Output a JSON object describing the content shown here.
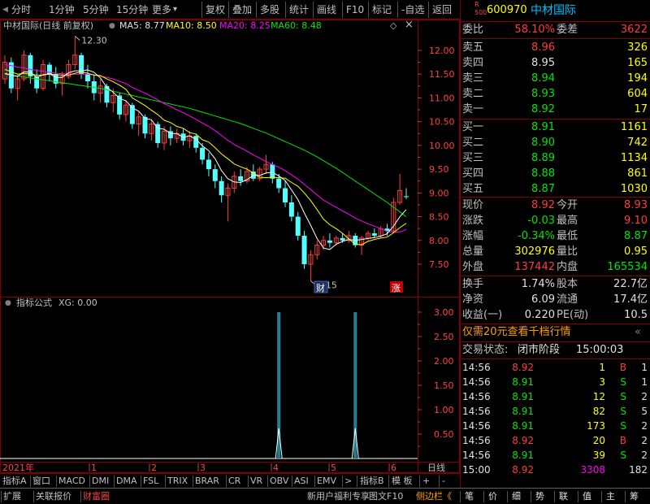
{
  "toolbar": {
    "left_items": [
      "分时",
      "1分钟",
      "5分钟",
      "15分钟",
      "更多"
    ],
    "right_items": [
      "复权",
      "叠加",
      "多股",
      "统计",
      "画线",
      "F10",
      "标记",
      "-自选",
      "返回"
    ]
  },
  "chart_header": {
    "name": "中材国际(日线 前复权)",
    "ma5": "MA5: 8.77",
    "ma10": "MA10: 8.50",
    "ma20": "MA20: 8.25",
    "ma60": "MA60: 8.48",
    "high_label": "12.30",
    "low_label": "7.15",
    "badge_cai": "财",
    "badge_zhang": "涨"
  },
  "indicator_header": {
    "name": "指标公式",
    "value": "XG: 0.00"
  },
  "colors": {
    "up": "#ff3c3c",
    "down": "#54ffff",
    "ma5": "#ffffff",
    "ma10": "#ffff00",
    "ma20": "#ff00ff",
    "ma60": "#00e600",
    "border": "#800000"
  },
  "chart_data": {
    "type": "candlestick",
    "y_axis": {
      "ticks": [
        "12.00",
        "11.50",
        "11.00",
        "10.50",
        "10.00",
        "9.50",
        "9.00",
        "8.50",
        "8.00",
        "7.50"
      ],
      "min": 7.0,
      "max": 12.5
    },
    "indicator_axis": {
      "ticks": [
        "3.00",
        "2.50",
        "2.00",
        "1.50",
        "1.00",
        "0.50"
      ],
      "min": 0,
      "max": 3.3
    },
    "x_labels": [
      "2021年",
      "1",
      "2",
      "3",
      "4",
      "5",
      "6"
    ],
    "period_label": "日线",
    "candles": [
      [
        11.4,
        11.9,
        11.3,
        11.75
      ],
      [
        11.75,
        11.85,
        11.1,
        11.2
      ],
      [
        11.2,
        11.5,
        10.95,
        11.4
      ],
      [
        11.4,
        12.0,
        11.35,
        11.9
      ],
      [
        11.9,
        11.95,
        11.3,
        11.45
      ],
      [
        11.45,
        11.6,
        11.1,
        11.2
      ],
      [
        11.2,
        11.8,
        11.15,
        11.7
      ],
      [
        11.7,
        11.75,
        11.35,
        11.5
      ],
      [
        11.5,
        11.65,
        11.2,
        11.3
      ],
      [
        11.3,
        11.55,
        11.05,
        11.45
      ],
      [
        11.45,
        11.8,
        11.4,
        11.7
      ],
      [
        11.7,
        12.3,
        11.6,
        11.9
      ],
      [
        11.9,
        11.95,
        11.4,
        11.5
      ],
      [
        11.5,
        11.7,
        11.2,
        11.35
      ],
      [
        11.35,
        11.5,
        10.95,
        11.1
      ],
      [
        11.1,
        11.4,
        10.9,
        11.25
      ],
      [
        11.25,
        11.3,
        10.8,
        10.9
      ],
      [
        10.9,
        11.2,
        10.7,
        11.05
      ],
      [
        11.05,
        11.1,
        10.55,
        10.65
      ],
      [
        10.65,
        10.95,
        10.5,
        10.85
      ],
      [
        10.85,
        10.9,
        10.35,
        10.45
      ],
      [
        10.45,
        10.7,
        10.2,
        10.6
      ],
      [
        10.6,
        10.65,
        10.15,
        10.25
      ],
      [
        10.25,
        10.55,
        10.1,
        10.45
      ],
      [
        10.45,
        10.5,
        9.95,
        10.05
      ],
      [
        10.05,
        10.4,
        9.9,
        10.3
      ],
      [
        10.3,
        10.4,
        10.0,
        10.15
      ],
      [
        10.15,
        10.35,
        10.05,
        10.25
      ],
      [
        10.25,
        10.35,
        10.0,
        10.1
      ],
      [
        10.1,
        10.3,
        9.95,
        10.2
      ],
      [
        10.2,
        10.25,
        9.85,
        9.95
      ],
      [
        9.95,
        10.05,
        9.6,
        9.7
      ],
      [
        9.7,
        9.85,
        9.35,
        9.5
      ],
      [
        9.5,
        9.6,
        9.1,
        9.25
      ],
      [
        9.25,
        9.35,
        8.8,
        8.95
      ],
      [
        8.95,
        9.2,
        8.4,
        9.1
      ],
      [
        9.1,
        9.45,
        9.0,
        9.35
      ],
      [
        9.35,
        9.5,
        9.15,
        9.25
      ],
      [
        9.25,
        9.55,
        9.2,
        9.45
      ],
      [
        9.45,
        9.6,
        9.25,
        9.3
      ],
      [
        9.3,
        9.55,
        9.25,
        9.5
      ],
      [
        9.5,
        9.8,
        9.4,
        9.6
      ],
      [
        9.6,
        9.65,
        9.2,
        9.3
      ],
      [
        9.3,
        9.4,
        9.0,
        9.1
      ],
      [
        9.1,
        9.25,
        8.7,
        8.8
      ],
      [
        8.8,
        8.95,
        8.4,
        8.5
      ],
      [
        8.5,
        8.6,
        8.0,
        8.1
      ],
      [
        8.1,
        8.2,
        7.4,
        7.5
      ],
      [
        7.5,
        7.8,
        7.15,
        7.7
      ],
      [
        7.7,
        8.0,
        7.6,
        7.9
      ],
      [
        7.9,
        8.1,
        7.8,
        8.0
      ],
      [
        8.0,
        8.15,
        7.85,
        7.95
      ],
      [
        7.95,
        8.1,
        7.9,
        8.05
      ],
      [
        8.05,
        8.15,
        7.95,
        8.0
      ],
      [
        8.0,
        8.2,
        7.95,
        8.1
      ],
      [
        8.1,
        8.15,
        7.85,
        7.9
      ],
      [
        7.9,
        8.1,
        7.7,
        8.05
      ],
      [
        8.05,
        8.2,
        8.0,
        8.15
      ],
      [
        8.15,
        8.25,
        8.05,
        8.1
      ],
      [
        8.1,
        8.3,
        8.05,
        8.25
      ],
      [
        8.25,
        8.35,
        8.1,
        8.2
      ],
      [
        8.2,
        8.9,
        8.15,
        8.8
      ],
      [
        8.8,
        9.4,
        8.75,
        9.05
      ],
      [
        8.93,
        9.1,
        8.87,
        8.92
      ]
    ],
    "ma5": [
      11.52,
      11.48,
      11.45,
      11.55,
      11.54,
      11.43,
      11.49,
      11.51,
      11.43,
      11.43,
      11.53,
      11.57,
      11.57,
      11.59,
      11.54,
      11.42,
      11.22,
      11.12,
      10.99,
      10.94,
      10.79,
      10.72,
      10.57,
      10.54,
      10.36,
      10.34,
      10.25,
      10.25,
      10.17,
      10.2,
      10.13,
      9.99,
      9.89,
      9.72,
      9.47,
      9.3,
      9.23,
      9.22,
      9.28,
      9.37,
      9.37,
      9.42,
      9.43,
      9.36,
      9.26,
      9.06,
      8.86,
      8.58,
      8.32,
      8.04,
      7.84,
      7.81,
      7.92,
      7.98,
      8.02,
      8.0,
      8.02,
      8.04,
      8.06,
      8.09,
      8.14,
      8.3,
      8.5,
      8.65
    ],
    "ma10": [
      11.6,
      11.55,
      11.5,
      11.52,
      11.5,
      11.48,
      11.48,
      11.5,
      11.49,
      11.48,
      11.48,
      11.52,
      11.55,
      11.52,
      11.48,
      11.47,
      11.4,
      11.34,
      11.27,
      11.18,
      11.0,
      10.92,
      10.84,
      10.74,
      10.65,
      10.53,
      10.48,
      10.4,
      10.36,
      10.27,
      10.24,
      10.12,
      10.07,
      9.95,
      9.82,
      9.72,
      9.61,
      9.55,
      9.5,
      9.42,
      9.33,
      9.32,
      9.33,
      9.32,
      9.31,
      9.22,
      9.14,
      9.0,
      8.84,
      8.65,
      8.45,
      8.33,
      8.25,
      8.15,
      8.03,
      7.92,
      7.91,
      7.98,
      8.02,
      8.05,
      8.07,
      8.16,
      8.27,
      8.36
    ],
    "ma20": [
      11.7,
      11.68,
      11.65,
      11.63,
      11.6,
      11.58,
      11.56,
      11.54,
      11.52,
      11.51,
      11.5,
      11.5,
      11.5,
      11.5,
      11.48,
      11.46,
      11.43,
      11.4,
      11.35,
      11.3,
      11.22,
      11.16,
      11.1,
      11.03,
      10.96,
      10.88,
      10.82,
      10.75,
      10.69,
      10.62,
      10.55,
      10.47,
      10.4,
      10.31,
      10.21,
      10.11,
      10.02,
      9.95,
      9.88,
      9.8,
      9.73,
      9.66,
      9.6,
      9.54,
      9.47,
      9.38,
      9.29,
      9.18,
      9.07,
      8.96,
      8.85,
      8.77,
      8.7,
      8.62,
      8.55,
      8.47,
      8.41,
      8.35,
      8.3,
      8.25,
      8.19,
      8.17,
      8.18,
      8.23
    ],
    "ma60": [
      11.5,
      11.48,
      11.46,
      11.44,
      11.42,
      11.4,
      11.38,
      11.36,
      11.34,
      11.32,
      11.3,
      11.28,
      11.26,
      11.24,
      11.22,
      11.2,
      11.17,
      11.14,
      11.11,
      11.08,
      11.05,
      11.02,
      10.99,
      10.96,
      10.93,
      10.9,
      10.87,
      10.84,
      10.81,
      10.78,
      10.74,
      10.7,
      10.66,
      10.62,
      10.58,
      10.54,
      10.5,
      10.46,
      10.41,
      10.36,
      10.31,
      10.26,
      10.2,
      10.14,
      10.08,
      10.02,
      9.96,
      9.9,
      9.83,
      9.76,
      9.68,
      9.6,
      9.52,
      9.43,
      9.34,
      9.25,
      9.16,
      9.07,
      8.98,
      8.89,
      8.8,
      8.7,
      8.6,
      8.5
    ],
    "signals": [
      {
        "index": 43,
        "value": 3.0
      },
      {
        "index": 55,
        "value": 3.0
      }
    ]
  },
  "quote": {
    "code": "600970",
    "name": "中材国际",
    "badge_r": "R",
    "badge_500": "500",
    "weibi_label": "委比",
    "weibi": "58.10%",
    "weicha_label": "委差",
    "weicha": "3622",
    "asks": [
      {
        "label": "卖五",
        "price": "8.96",
        "vol": "326"
      },
      {
        "label": "卖四",
        "price": "8.95",
        "vol": "165"
      },
      {
        "label": "卖三",
        "price": "8.94",
        "vol": "194"
      },
      {
        "label": "卖二",
        "price": "8.93",
        "vol": "604"
      },
      {
        "label": "卖一",
        "price": "8.92",
        "vol": "17"
      }
    ],
    "bids": [
      {
        "label": "买一",
        "price": "8.91",
        "vol": "1161"
      },
      {
        "label": "买二",
        "price": "8.90",
        "vol": "742"
      },
      {
        "label": "买三",
        "price": "8.89",
        "vol": "1134"
      },
      {
        "label": "买四",
        "price": "8.88",
        "vol": "861"
      },
      {
        "label": "买五",
        "price": "8.87",
        "vol": "1030"
      }
    ],
    "stats": [
      {
        "l1": "现价",
        "v1": "8.92",
        "c1": "red",
        "l2": "今开",
        "v2": "8.93",
        "c2": "red"
      },
      {
        "l1": "涨跌",
        "v1": "-0.03",
        "c1": "grn",
        "l2": "最高",
        "v2": "9.10",
        "c2": "red"
      },
      {
        "l1": "涨幅",
        "v1": "-0.34%",
        "c1": "grn",
        "l2": "最低",
        "v2": "8.87",
        "c2": "grn"
      },
      {
        "l1": "总量",
        "v1": "302976",
        "c1": "yel",
        "l2": "量比",
        "v2": "0.95",
        "c2": "yel"
      },
      {
        "l1": "外盘",
        "v1": "137442",
        "c1": "red",
        "l2": "内盘",
        "v2": "165534",
        "c2": "grn"
      }
    ],
    "stats2": [
      {
        "l1": "换手",
        "v1": "1.74%",
        "l2": "股本",
        "v2": "22.7亿"
      },
      {
        "l1": "净资",
        "v1": "6.09",
        "l2": "流通",
        "v2": "17.4亿"
      },
      {
        "l1": "收益(一)",
        "v1": "0.220",
        "l2": "PE(动)",
        "v2": "10.5"
      }
    ],
    "promo": "仅需20元查看千档行情",
    "trade_status_label": "交易状态:",
    "trade_status": "闭市阶段",
    "trade_time": "15:00:03",
    "ticks": [
      {
        "t": "14:56",
        "p": "8.92",
        "pc": "red",
        "v": "1",
        "vc": "yel",
        "d": "B",
        "dc": "red",
        "n": "1"
      },
      {
        "t": "14:56",
        "p": "8.91",
        "pc": "grn",
        "v": "3",
        "vc": "yel",
        "d": "S",
        "dc": "grn",
        "n": "1"
      },
      {
        "t": "14:56",
        "p": "8.91",
        "pc": "grn",
        "v": "12",
        "vc": "yel",
        "d": "S",
        "dc": "grn",
        "n": "2"
      },
      {
        "t": "14:56",
        "p": "8.91",
        "pc": "grn",
        "v": "82",
        "vc": "yel",
        "d": "S",
        "dc": "grn",
        "n": "5"
      },
      {
        "t": "14:56",
        "p": "8.91",
        "pc": "grn",
        "v": "173",
        "vc": "yel",
        "d": "S",
        "dc": "grn",
        "n": "2"
      },
      {
        "t": "14:56",
        "p": "8.92",
        "pc": "red",
        "v": "20",
        "vc": "yel",
        "d": "B",
        "dc": "red",
        "n": "2"
      },
      {
        "t": "14:56",
        "p": "8.91",
        "pc": "grn",
        "v": "39",
        "vc": "yel",
        "d": "S",
        "dc": "grn",
        "n": "2"
      },
      {
        "t": "15:00",
        "p": "8.92",
        "pc": "red",
        "v": "3308",
        "vc": "mag",
        "d": "",
        "dc": "wht",
        "n": "182"
      }
    ]
  },
  "tabs": {
    "left": [
      "指标A",
      "窗口",
      "MACD",
      "DMI",
      "DMA",
      "FSL",
      "TRIX",
      "BRAR",
      "CR",
      "VR",
      "OBV",
      "ASI",
      "EMV",
      ">"
    ],
    "right": [
      "指标B",
      "模 板",
      "+",
      "-"
    ]
  },
  "statusbar": {
    "left": [
      "扩展",
      "关联报价",
      "财富圈"
    ],
    "right": [
      "新用户福利专享",
      "图文F10",
      "侧边栏《"
    ],
    "panel_tabs": [
      "笔",
      "价",
      "细",
      "势",
      "联",
      "值",
      "主",
      "筹"
    ]
  }
}
